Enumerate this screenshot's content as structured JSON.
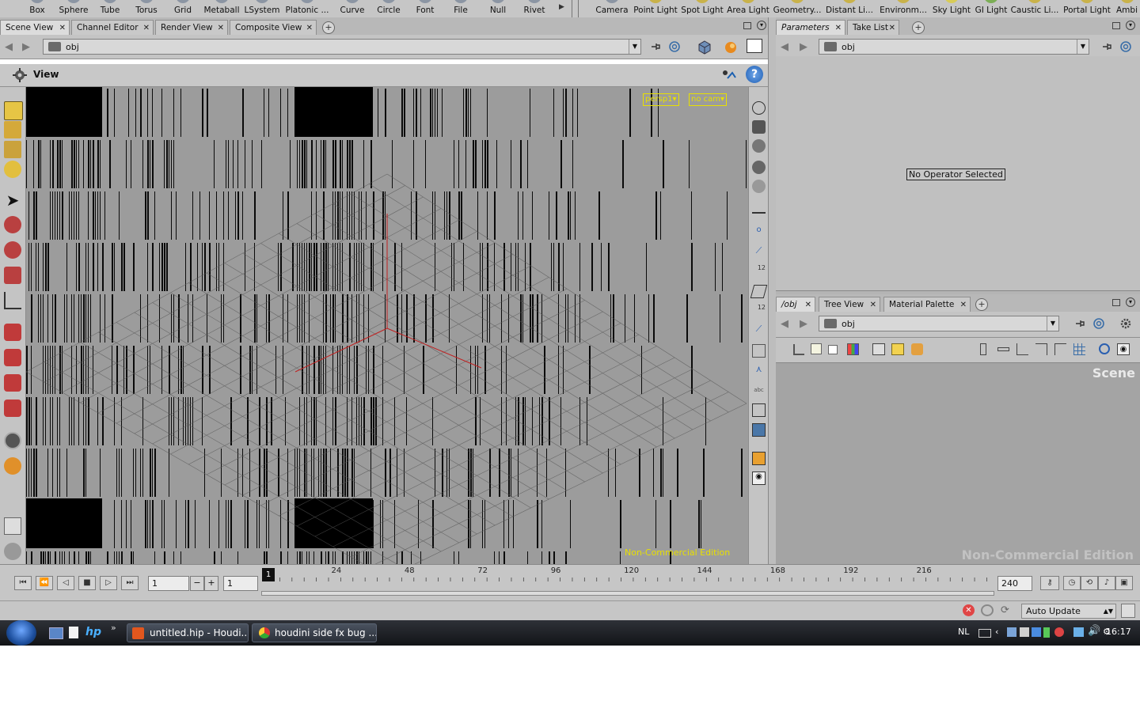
{
  "shelf": {
    "tools": [
      "Box",
      "Sphere",
      "Tube",
      "Torus",
      "Grid",
      "Metaball",
      "LSystem",
      "Platonic ...",
      "Curve",
      "Circle",
      "Font",
      "File",
      "Null",
      "Rivet"
    ],
    "lights": [
      "Camera",
      "Point Light",
      "Spot Light",
      "Area Light",
      "Geometry...",
      "Distant Li...",
      "Environm...",
      "Sky Light",
      "GI Light",
      "Caustic Li...",
      "Portal Light",
      "Ambi"
    ]
  },
  "left_tabs": [
    {
      "label": "Scene View",
      "active": true
    },
    {
      "label": "Channel Editor",
      "active": false
    },
    {
      "label": "Render View",
      "active": false
    },
    {
      "label": "Composite View",
      "active": false
    }
  ],
  "scene_path": "obj",
  "view_title": "View",
  "viewport": {
    "persp_label": "persp1",
    "cam_label": "no cam",
    "watermark": "Non-Commercial Edition"
  },
  "params_tabs": [
    {
      "label": "Parameters",
      "active": true
    },
    {
      "label": "Take List",
      "active": false
    }
  ],
  "params_path": "obj",
  "params_message": "No Operator Selected",
  "net_tabs": [
    {
      "label": "/obj",
      "active": true
    },
    {
      "label": "Tree View",
      "active": false
    },
    {
      "label": "Material Palette",
      "active": false
    }
  ],
  "net_path": "obj",
  "net": {
    "context_label": "Scene",
    "watermark": "Non-Commercial Edition"
  },
  "timeline": {
    "current_frame": "1",
    "start_frame": "1",
    "end_frame": "240",
    "cursor_label": "1",
    "ticks": [
      "24",
      "48",
      "72",
      "96",
      "120",
      "144",
      "168",
      "192",
      "216"
    ]
  },
  "status": {
    "update_mode": "Auto Update"
  },
  "taskbar": {
    "tasks": [
      "untitled.hip - Houdi...",
      "houdini side fx bug ..."
    ],
    "lang": "NL",
    "clock": "16:17"
  },
  "colors": {
    "accent_yellow": "#e8e000",
    "grid_red": "#c02020",
    "viewport_bg": "#9c9c9c"
  }
}
